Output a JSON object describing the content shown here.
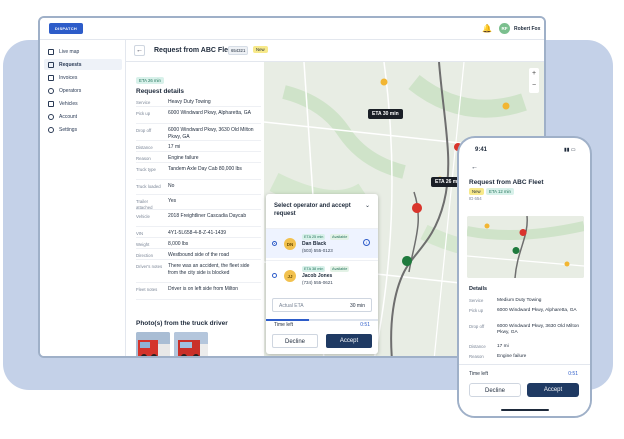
{
  "brand": {
    "logo_text": "DISPATCH"
  },
  "user": {
    "initials": "RF",
    "name": "Robert Fox"
  },
  "sidebar": {
    "items": [
      {
        "label": "Live map",
        "icon": "map-icon"
      },
      {
        "label": "Requests",
        "icon": "list-icon"
      },
      {
        "label": "Invoices",
        "icon": "invoice-icon"
      },
      {
        "label": "Operators",
        "icon": "user-icon"
      },
      {
        "label": "Vehicles",
        "icon": "truck-icon"
      },
      {
        "label": "Account",
        "icon": "account-icon"
      },
      {
        "label": "Settings",
        "icon": "gear-icon"
      }
    ],
    "active_index": 1
  },
  "request": {
    "title": "Request from ABC Fleet",
    "id": "654321",
    "status": "New",
    "eta_chip": "ETA 26 min",
    "section": "Request details",
    "details": [
      {
        "k": "Service",
        "v": "Heavy Duty Towing"
      },
      {
        "k": "Pick up",
        "v": "6000 Windward Pkwy, Alpharetta, GA"
      },
      {
        "k": "Drop off",
        "v": "6000 Windward Pkwy, 3630 Old Milton Pkwy, GA"
      },
      {
        "k": "Distance",
        "v": "17 mi"
      },
      {
        "k": "Reason",
        "v": "Engine failure"
      },
      {
        "k": "Truck type",
        "v": "Tandem Axle Day Cab 80,000 lbs"
      },
      {
        "k": "Truck loaded",
        "v": "No"
      },
      {
        "k": "Trailer attached",
        "v": "Yes"
      },
      {
        "k": "Vehicle",
        "v": "2018 Freightliner Cascadia Daycab"
      },
      {
        "k": "VIN",
        "v": "4Y1-5L658-4-8-Z-41-1439"
      },
      {
        "k": "Weight",
        "v": "8,000 lbs"
      },
      {
        "k": "Direction",
        "v": "Westbound side of the road"
      },
      {
        "k": "Driver's notes",
        "v": "There was an accident, the fleet side from the city side is blocked"
      },
      {
        "k": "Fleet notes",
        "v": "Driver is on left side from Milton"
      }
    ],
    "photos_heading": "Photo(s) from the truck driver"
  },
  "map": {
    "eta_labels": [
      "ETA 30 min",
      "ETA 26 min"
    ],
    "zoom_in": "+",
    "zoom_out": "−"
  },
  "assign": {
    "title": "Select operator and accept request",
    "operators": [
      {
        "initials": "DN",
        "eta": "ETA 25 min",
        "status": "Available",
        "name": "Dan Black",
        "phone": "(503) 555-0123"
      },
      {
        "initials": "JJ",
        "eta": "ETA 38 min",
        "status": "Available",
        "name": "Jacob Jones",
        "phone": "(734) 555-0621"
      }
    ],
    "eta_placeholder": "Actual ETA",
    "eta_value": "30 min",
    "time_left_label": "Time left",
    "time_left_value": "0:51",
    "time_left_fraction": 0.38,
    "decline": "Decline",
    "accept": "Accept"
  },
  "phone": {
    "time": "9:41",
    "title": "Request from ABC Fleet",
    "status": "New",
    "eta_chip": "ETA 12 min",
    "id": "ID 654",
    "details_heading": "Details",
    "details": [
      {
        "k": "Service",
        "v": "Medium Duty Towing"
      },
      {
        "k": "Pick up",
        "v": "6000 Windward Pkwy, Alpharetta, GA"
      },
      {
        "k": "Drop off",
        "v": "6000 Windward Pkwy, 3630 Old Milton Pkwy, GA"
      },
      {
        "k": "Distance",
        "v": "17 mi"
      },
      {
        "k": "Reason",
        "v": "Engine failure"
      }
    ],
    "time_left_label": "Time left",
    "time_left_value": "0:51",
    "decline": "Decline",
    "accept": "Accept"
  }
}
